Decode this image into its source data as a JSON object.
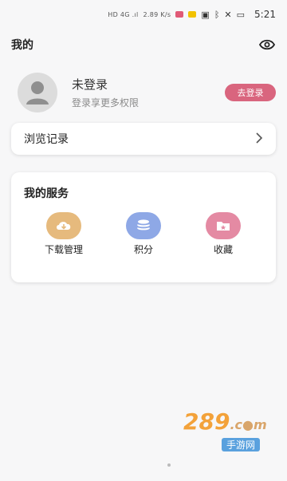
{
  "status": {
    "signal_text": "HD 4G .ıl",
    "speed": "2.89 K/s",
    "icons": [
      "nfc-icon",
      "bluetooth-icon",
      "mute-icon",
      "battery-icon"
    ],
    "time": "5:21"
  },
  "header": {
    "title": "我的"
  },
  "profile": {
    "name": "未登录",
    "subtitle": "登录享更多权限",
    "login_button": "去登录"
  },
  "history": {
    "label": "浏览记录"
  },
  "services": {
    "title": "我的服务",
    "items": [
      {
        "label": "下载管理",
        "icon": "cloud-download-icon",
        "color": "#e6ba7d"
      },
      {
        "label": "积分",
        "icon": "coin-stack-icon",
        "color": "#8ea8e6"
      },
      {
        "label": "收藏",
        "icon": "star-folder-icon",
        "color": "#e48aa3"
      }
    ]
  },
  "watermark": {
    "main": "289",
    "suffix": ".c●m",
    "sub": "手游网"
  },
  "colors": {
    "accent": "#d9657e",
    "background": "#f7f7f8"
  }
}
